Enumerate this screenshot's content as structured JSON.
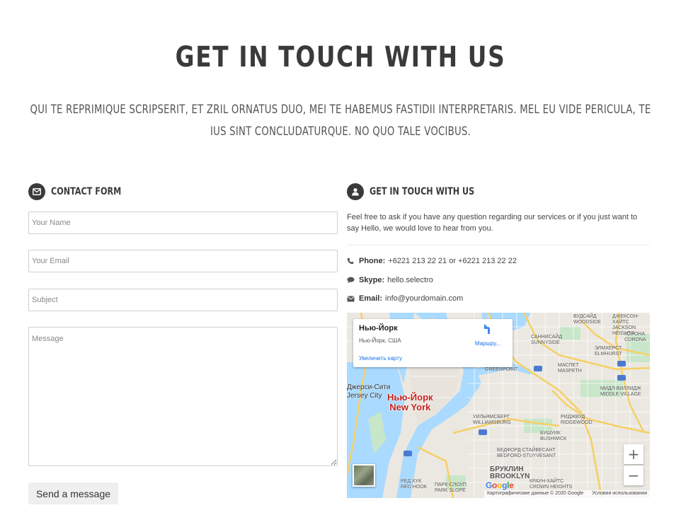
{
  "header": {
    "title": "GET IN TOUCH WITH US",
    "intro": "Qui te reprimique scripserit, et zril ornatus duo, mei te habemus fastidii interpretaris. Mel eu vide pericula, te ius sint concludaturque. No quo tale vocibus."
  },
  "contact_form": {
    "heading": "CONTACT FORM",
    "icon": "envelope-icon",
    "name_placeholder": "Your Name",
    "email_placeholder": "Your Email",
    "subject_placeholder": "Subject",
    "message_placeholder": "Message",
    "submit_label": "Send a message",
    "submit_bg": "#efefef"
  },
  "info": {
    "heading": "GET IN TOUCH WITH US",
    "icon": "user-icon",
    "description": "Feel free to ask if you have any question regarding our services or if you just want to say Hello, we would love to hear from you.",
    "phone_label": "Phone:",
    "phone_value": "+6221 213 22 21 or +6221 213 22 22",
    "skype_label": "Skype:",
    "skype_value": "hello.selectro",
    "email_label": "Email:",
    "email_value": "info@yourdomain.com"
  },
  "map": {
    "card": {
      "place_name": "Нью-Йорк",
      "address": "Нью-Йорк, США",
      "directions_label": "Маршру...",
      "enlarge_label": "Увеличить карту"
    },
    "city_label_ru": "Нью-Йорк",
    "city_label_en": "New York",
    "zoom_in": "+",
    "zoom_out": "−",
    "footer_data": "Картографические данные © 2020 Google",
    "footer_terms": "Условия использования",
    "labels": {
      "jersey_city_ru": "Джерси-Сити",
      "jersey_city_en": "Jersey City",
      "brooklyn_ru": "БРУКЛИН",
      "brooklyn_en": "BROOKLYN",
      "williamsburg_ru": "УИЛЬЯМСБЕРГ",
      "williamsburg_en": "WILLIAMSBURG",
      "greenpoint": "GREENPOINT",
      "woodside_ru": "ВУДСАЙД",
      "woodside_en": "WOODSIDE",
      "jackson_heights_ru": "ДЖЕКСОН-ХАЙТС",
      "jackson_heights_en": "JACKSON HEIGHTS",
      "corona_ru": "КОРОНА",
      "corona_en": "CORONA",
      "sunnyside_ru": "САННИСАЙД",
      "sunnyside_en": "SUNNYSIDE",
      "elmhurst_ru": "ЭЛМХЕРСТ",
      "elmhurst_en": "ELMHURST",
      "maspeth_ru": "МАСПЕТ",
      "maspeth_en": "MASPETH",
      "middle_village_ru": "МИДЛ-ВИЛЛИДЖ",
      "middle_village_en": "MIDDLE VILLAGE",
      "ridgewood_ru": "РИДЖВУД",
      "ridgewood_en": "RIDGEWOOD",
      "bushwick_ru": "БУШУИК",
      "bushwick_en": "BUSHWICK",
      "bed_stuy_ru": "БЕДФОРД-СТАЙВЕСАНТ",
      "bed_stuy_en": "BEDFORD-STUYVESANT",
      "crown_heights_ru": "КРАУН-ХАЙТС",
      "crown_heights_en": "CROWN HEIGHTS",
      "red_hook_ru": "РЕД ХУК",
      "red_hook_en": "RED HOOK",
      "park_slope_ru": "ПАРК-СЛОУП",
      "park_slope_en": "PARK SLOPE"
    },
    "colors": {
      "land": "#ebe8e1",
      "water": "#aadaff",
      "park": "#c8e6c9",
      "highway": "#f6cf65",
      "city_label": "#c5221f"
    }
  }
}
